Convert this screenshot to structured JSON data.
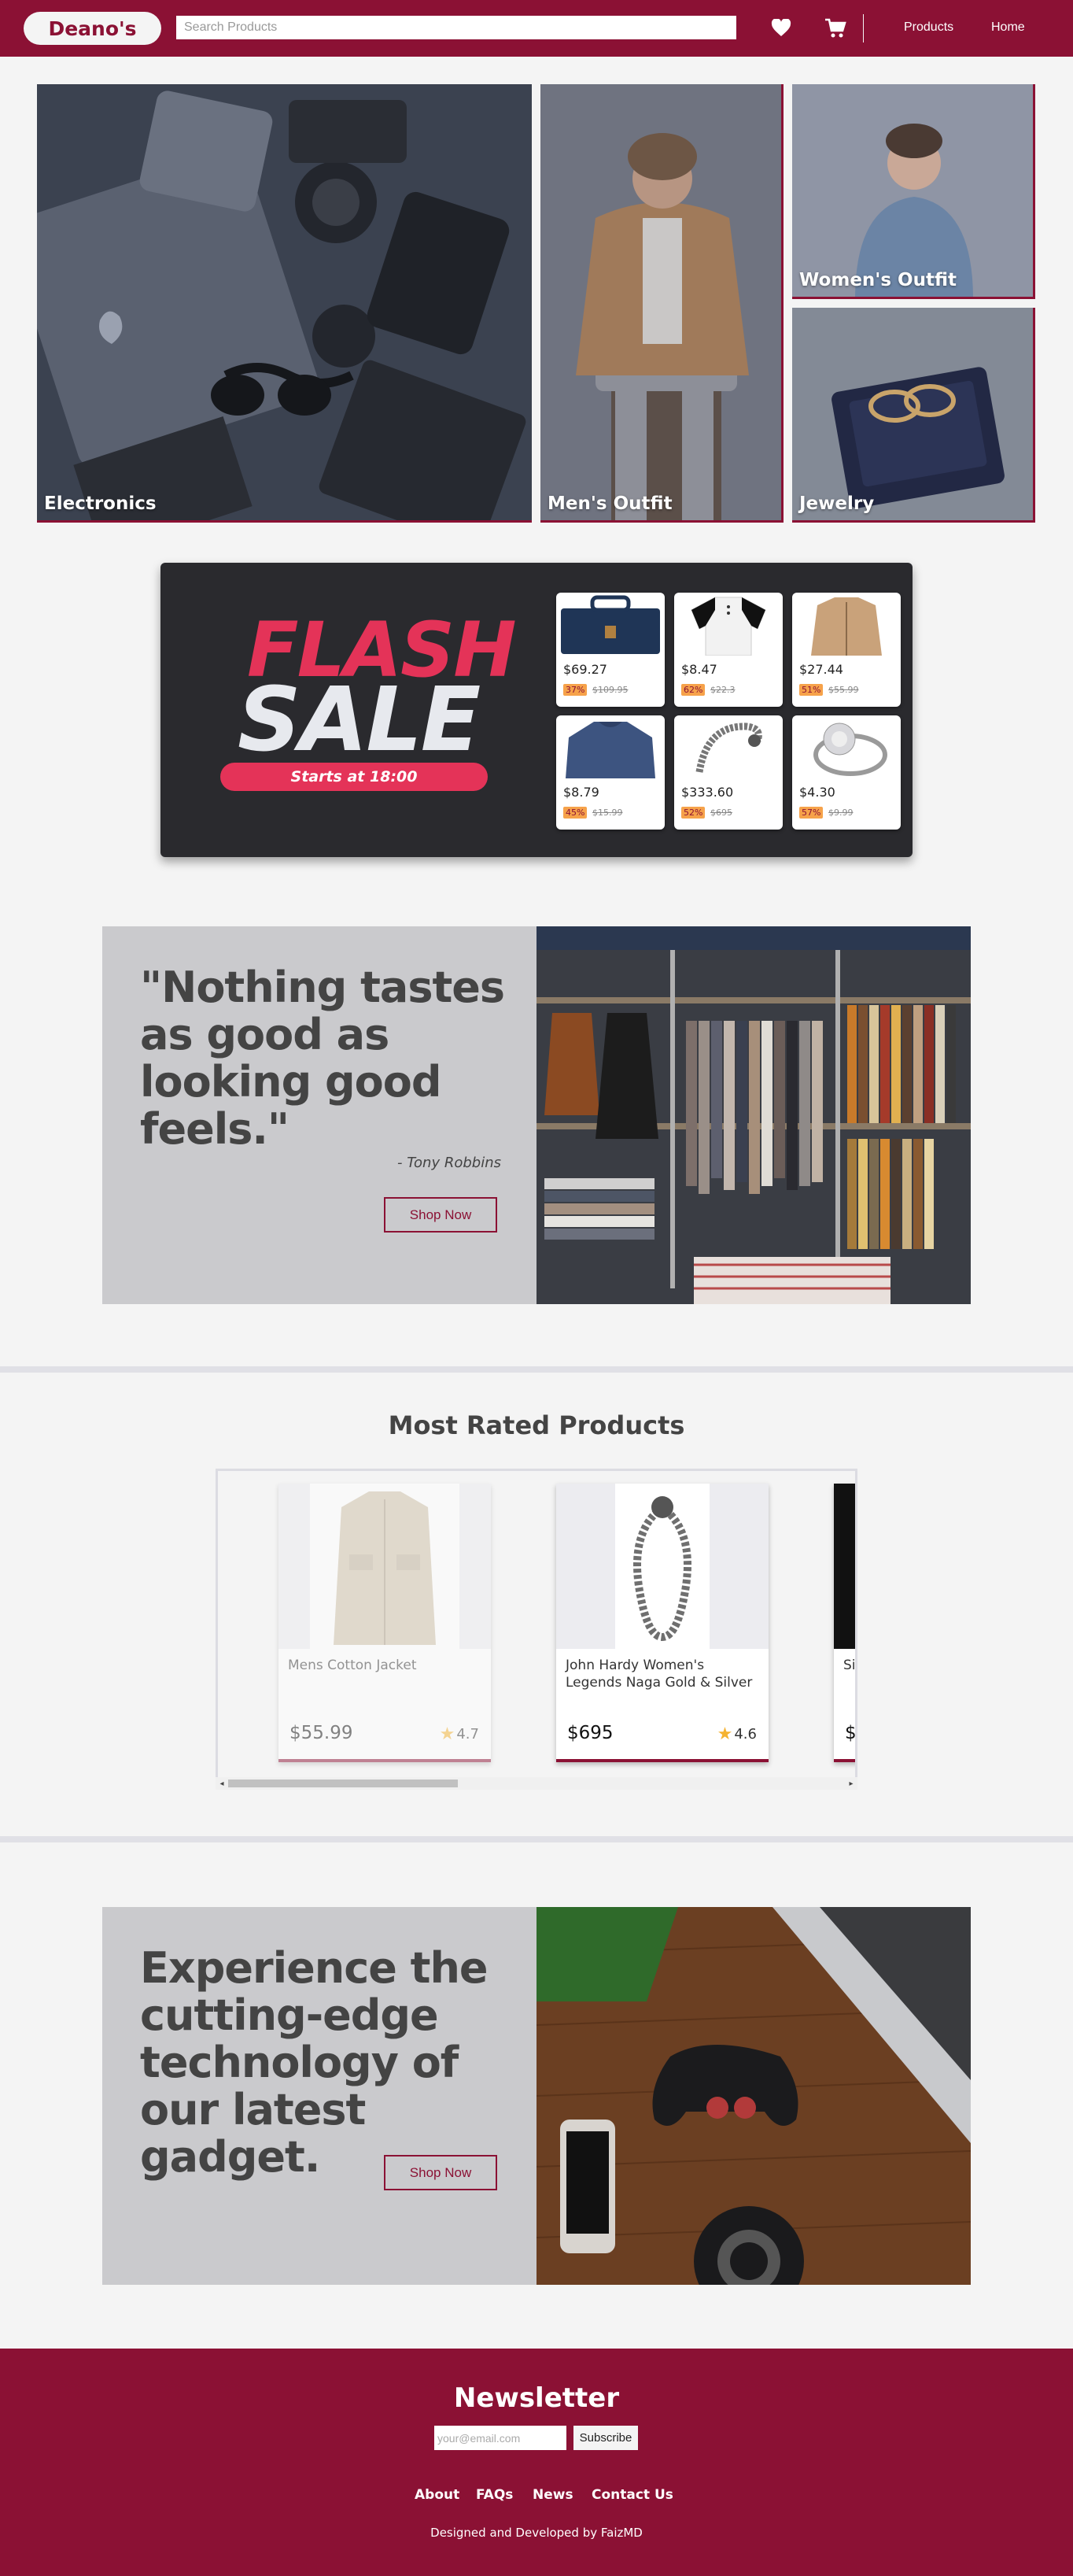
{
  "navbar": {
    "logo": "Deano's",
    "search_placeholder": "Search Products",
    "icons": {
      "wishlist": "heart-icon",
      "cart": "cart-icon"
    },
    "links": {
      "products": "Products",
      "home": "Home"
    }
  },
  "categories": {
    "electronics": "Electronics",
    "men": "Men's Outfit",
    "women": "Women's Outfit",
    "jewelry": "Jewelry"
  },
  "flash_sale": {
    "word1": "FLASH",
    "word2": "SALE",
    "starts": "Starts at 18:00",
    "items": [
      {
        "price": "$69.27",
        "discount": "37%",
        "old_price": "$109.95",
        "icon": "backpack-icon"
      },
      {
        "price": "$8.47",
        "discount": "62%",
        "old_price": "$22.3",
        "icon": "tshirt-icon"
      },
      {
        "price": "$27.44",
        "discount": "51%",
        "old_price": "$55.99",
        "icon": "jacket-icon"
      },
      {
        "price": "$8.79",
        "discount": "45%",
        "old_price": "$15.99",
        "icon": "sweater-icon"
      },
      {
        "price": "$333.60",
        "discount": "52%",
        "old_price": "$695",
        "icon": "bracelet-icon"
      },
      {
        "price": "$4.30",
        "discount": "57%",
        "old_price": "$9.99",
        "icon": "ring-icon"
      }
    ]
  },
  "banner1": {
    "quote": "\"Nothing tastes as good as looking good feels.\"",
    "author": "- Tony Robbins",
    "button": "Shop Now"
  },
  "most_rated": {
    "title": "Most Rated Products",
    "products": [
      {
        "name": "Mens Cotton Jacket",
        "price": "$55.99",
        "rating": "4.7"
      },
      {
        "name": "John Hardy Women's Legends Naga Gold & Silver",
        "price": "$695",
        "rating": "4.6"
      },
      {
        "name": "Sil NA",
        "price": "$",
        "rating": ""
      }
    ]
  },
  "banner2": {
    "headline": "Experience the cutting-edge technology of our latest gadget.",
    "button": "Shop Now"
  },
  "footer": {
    "newsletter_title": "Newsletter",
    "email_placeholder": "your@email.com",
    "subscribe": "Subscribe",
    "links": {
      "about": "About",
      "faqs": "FAQs",
      "news": "News",
      "contact": "Contact Us"
    },
    "credit": "Designed and Developed by FaizMD"
  },
  "colors": {
    "brand": "#8b1134",
    "flash_red": "#e43358",
    "background": "#f4f4f4",
    "banner_gray": "#cacacd"
  }
}
